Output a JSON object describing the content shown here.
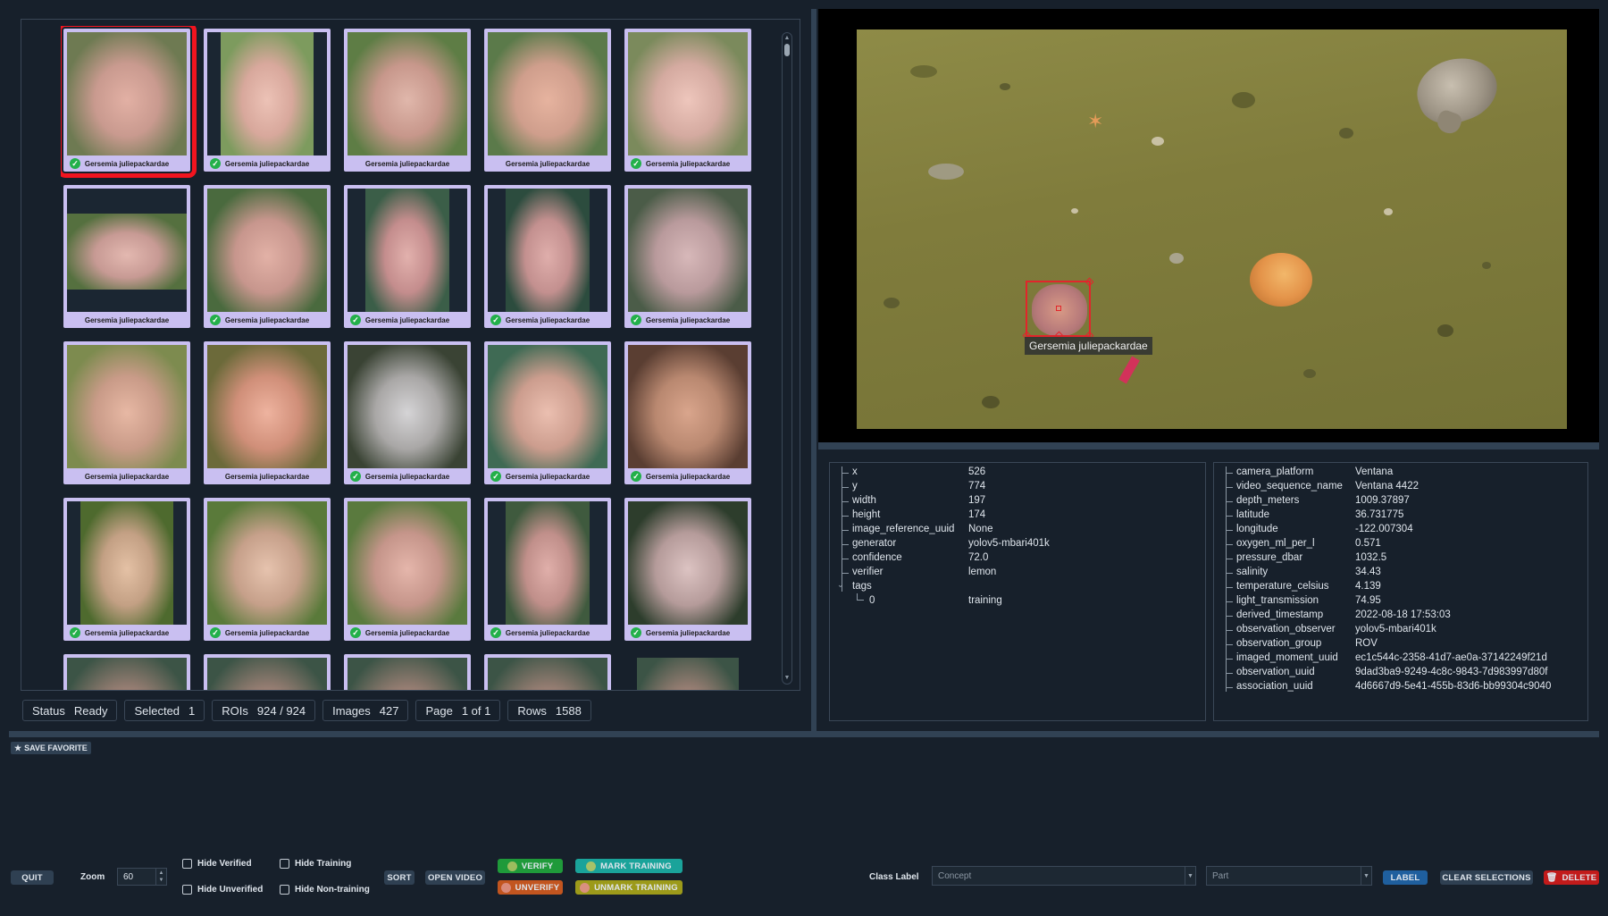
{
  "grid": {
    "thumbnails": [
      {
        "label": "Gersemia juliepackardae",
        "verified": true,
        "selected": true
      },
      {
        "label": "Gersemia juliepackardae",
        "verified": true,
        "selected": false
      },
      {
        "label": "Gersemia juliepackardae",
        "verified": false,
        "selected": false
      },
      {
        "label": "Gersemia juliepackardae",
        "verified": false,
        "selected": false
      },
      {
        "label": "Gersemia juliepackardae",
        "verified": true,
        "selected": false
      },
      {
        "label": "Gersemia juliepackardae",
        "verified": false,
        "selected": false
      },
      {
        "label": "Gersemia juliepackardae",
        "verified": true,
        "selected": false
      },
      {
        "label": "Gersemia juliepackardae",
        "verified": true,
        "selected": false
      },
      {
        "label": "Gersemia juliepackardae",
        "verified": true,
        "selected": false
      },
      {
        "label": "Gersemia juliepackardae",
        "verified": true,
        "selected": false
      },
      {
        "label": "Gersemia juliepackardae",
        "verified": false,
        "selected": false
      },
      {
        "label": "Gersemia juliepackardae",
        "verified": false,
        "selected": false
      },
      {
        "label": "Gersemia juliepackardae",
        "verified": true,
        "selected": false
      },
      {
        "label": "Gersemia juliepackardae",
        "verified": true,
        "selected": false
      },
      {
        "label": "Gersemia juliepackardae",
        "verified": true,
        "selected": false
      },
      {
        "label": "Gersemia juliepackardae",
        "verified": true,
        "selected": false
      },
      {
        "label": "Gersemia juliepackardae",
        "verified": true,
        "selected": false
      },
      {
        "label": "Gersemia juliepackardae",
        "verified": true,
        "selected": false
      },
      {
        "label": "Gersemia juliepackardae",
        "verified": true,
        "selected": false
      },
      {
        "label": "Gersemia juliepackardae",
        "verified": true,
        "selected": false
      }
    ]
  },
  "status_bar": {
    "status_label": "Status",
    "status_value": "Ready",
    "selected_label": "Selected",
    "selected_value": "1",
    "rois_label": "ROIs",
    "rois_value": "924 / 924",
    "images_label": "Images",
    "images_value": "427",
    "page_label": "Page",
    "page_value": "1 of 1",
    "rows_label": "Rows",
    "rows_value": "1588"
  },
  "video": {
    "bbox_label": "Gersemia juliepackardae"
  },
  "localization": {
    "fields": [
      {
        "key": "x",
        "value": "526"
      },
      {
        "key": "y",
        "value": "774"
      },
      {
        "key": "width",
        "value": "197"
      },
      {
        "key": "height",
        "value": "174"
      },
      {
        "key": "image_reference_uuid",
        "value": "None"
      },
      {
        "key": "generator",
        "value": "yolov5-mbari401k"
      },
      {
        "key": "confidence",
        "value": "72.0"
      },
      {
        "key": "verifier",
        "value": "lemon"
      },
      {
        "key": "tags",
        "value": ""
      }
    ],
    "tag_index": "0",
    "tag_value": "training"
  },
  "metadata": {
    "fields": [
      {
        "key": "camera_platform",
        "value": "Ventana"
      },
      {
        "key": "video_sequence_name",
        "value": "Ventana 4422"
      },
      {
        "key": "depth_meters",
        "value": "1009.37897"
      },
      {
        "key": "latitude",
        "value": "36.731775"
      },
      {
        "key": "longitude",
        "value": "-122.007304"
      },
      {
        "key": "oxygen_ml_per_l",
        "value": "0.571"
      },
      {
        "key": "pressure_dbar",
        "value": "1032.5"
      },
      {
        "key": "salinity",
        "value": "34.43"
      },
      {
        "key": "temperature_celsius",
        "value": "4.139"
      },
      {
        "key": "light_transmission",
        "value": "74.95"
      },
      {
        "key": "derived_timestamp",
        "value": "2022-08-18 17:53:03"
      },
      {
        "key": "observation_observer",
        "value": "yolov5-mbari401k"
      },
      {
        "key": "observation_group",
        "value": "ROV"
      },
      {
        "key": "imaged_moment_uuid",
        "value": "ec1c544c-2358-41d7-ae0a-37142249f21d"
      },
      {
        "key": "observation_uuid",
        "value": "9dad3ba9-9249-4c8c-9843-7d983997d80f"
      },
      {
        "key": "association_uuid",
        "value": "4d6667d9-5e41-455b-83d6-bb99304c9040"
      }
    ]
  },
  "toolbar": {
    "save_favorite": "SAVE FAVORITE",
    "quit": "QUIT",
    "zoom_label": "Zoom",
    "zoom_value": "60",
    "hide_verified": "Hide Verified",
    "hide_unverified": "Hide Unverified",
    "hide_training": "Hide Training",
    "hide_non_training": "Hide Non-training",
    "sort": "SORT",
    "open_video": "OPEN VIDEO",
    "verify": "VERIFY",
    "unverify": "UNVERIFY",
    "mark_training": "MARK TRAINING",
    "unmark_training": "UNMARK TRAINING",
    "class_label": "Class Label",
    "concept_placeholder": "Concept",
    "part_placeholder": "Part",
    "label": "LABEL",
    "clear_selections": "CLEAR SELECTIONS",
    "delete": "DELETE"
  },
  "colors": {
    "background": "#17202b",
    "thumb_border": "#c9bff1",
    "selected_outline": "#f2141f",
    "verify_green": "#1f9a3a",
    "unverify_orange": "#c2551f",
    "mark_training_teal": "#1aa39a",
    "unmark_training_olive": "#9c9a1a",
    "label_blue": "#1f5f9e",
    "delete_red": "#c21b1b"
  }
}
